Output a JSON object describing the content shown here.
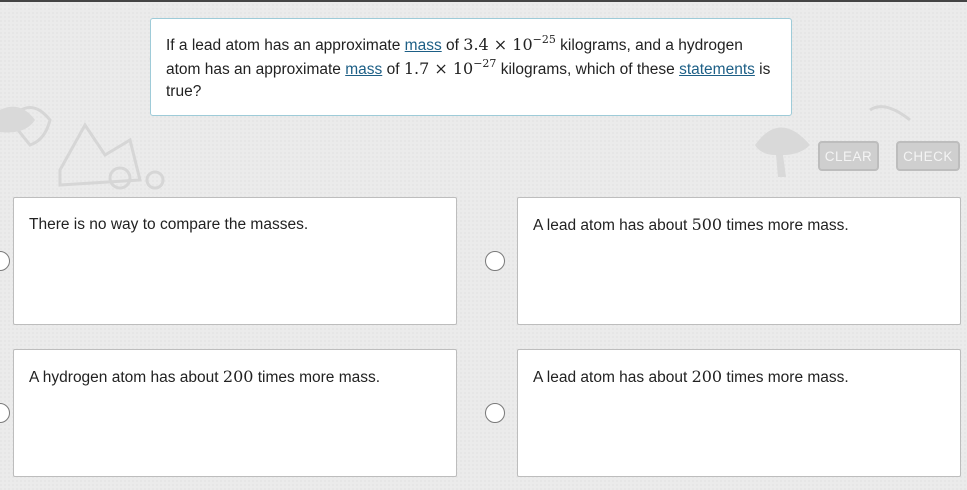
{
  "question": {
    "part1": "If a lead atom has an approximate ",
    "link_mass_1": "mass",
    "part2": " of ",
    "math1_base": "3.4 × 10",
    "math1_exp": "−25",
    "part3": " kilograms, and a hydrogen atom has an approximate ",
    "link_mass_2": "mass",
    "part4": " of ",
    "math2_base": "1.7 × 10",
    "math2_exp": "−27",
    "part5": " kilograms, which of these ",
    "link_statements": "statements",
    "part6": " is true?"
  },
  "buttons": {
    "clear": "CLEAR",
    "check": "CHECK"
  },
  "options": [
    {
      "pre": "There is no way to compare the masses.",
      "num": "",
      "post": ""
    },
    {
      "pre": "A lead atom has about ",
      "num": "500",
      "post": " times more mass."
    },
    {
      "pre": "A hydrogen atom has about ",
      "num": "200",
      "post": " times more mass."
    },
    {
      "pre": "A lead atom has about ",
      "num": "200",
      "post": " times more mass."
    }
  ],
  "colors": {
    "link": "#1d5f86",
    "question_border": "#9ecbd8",
    "button_bg": "#cfcfcf"
  }
}
